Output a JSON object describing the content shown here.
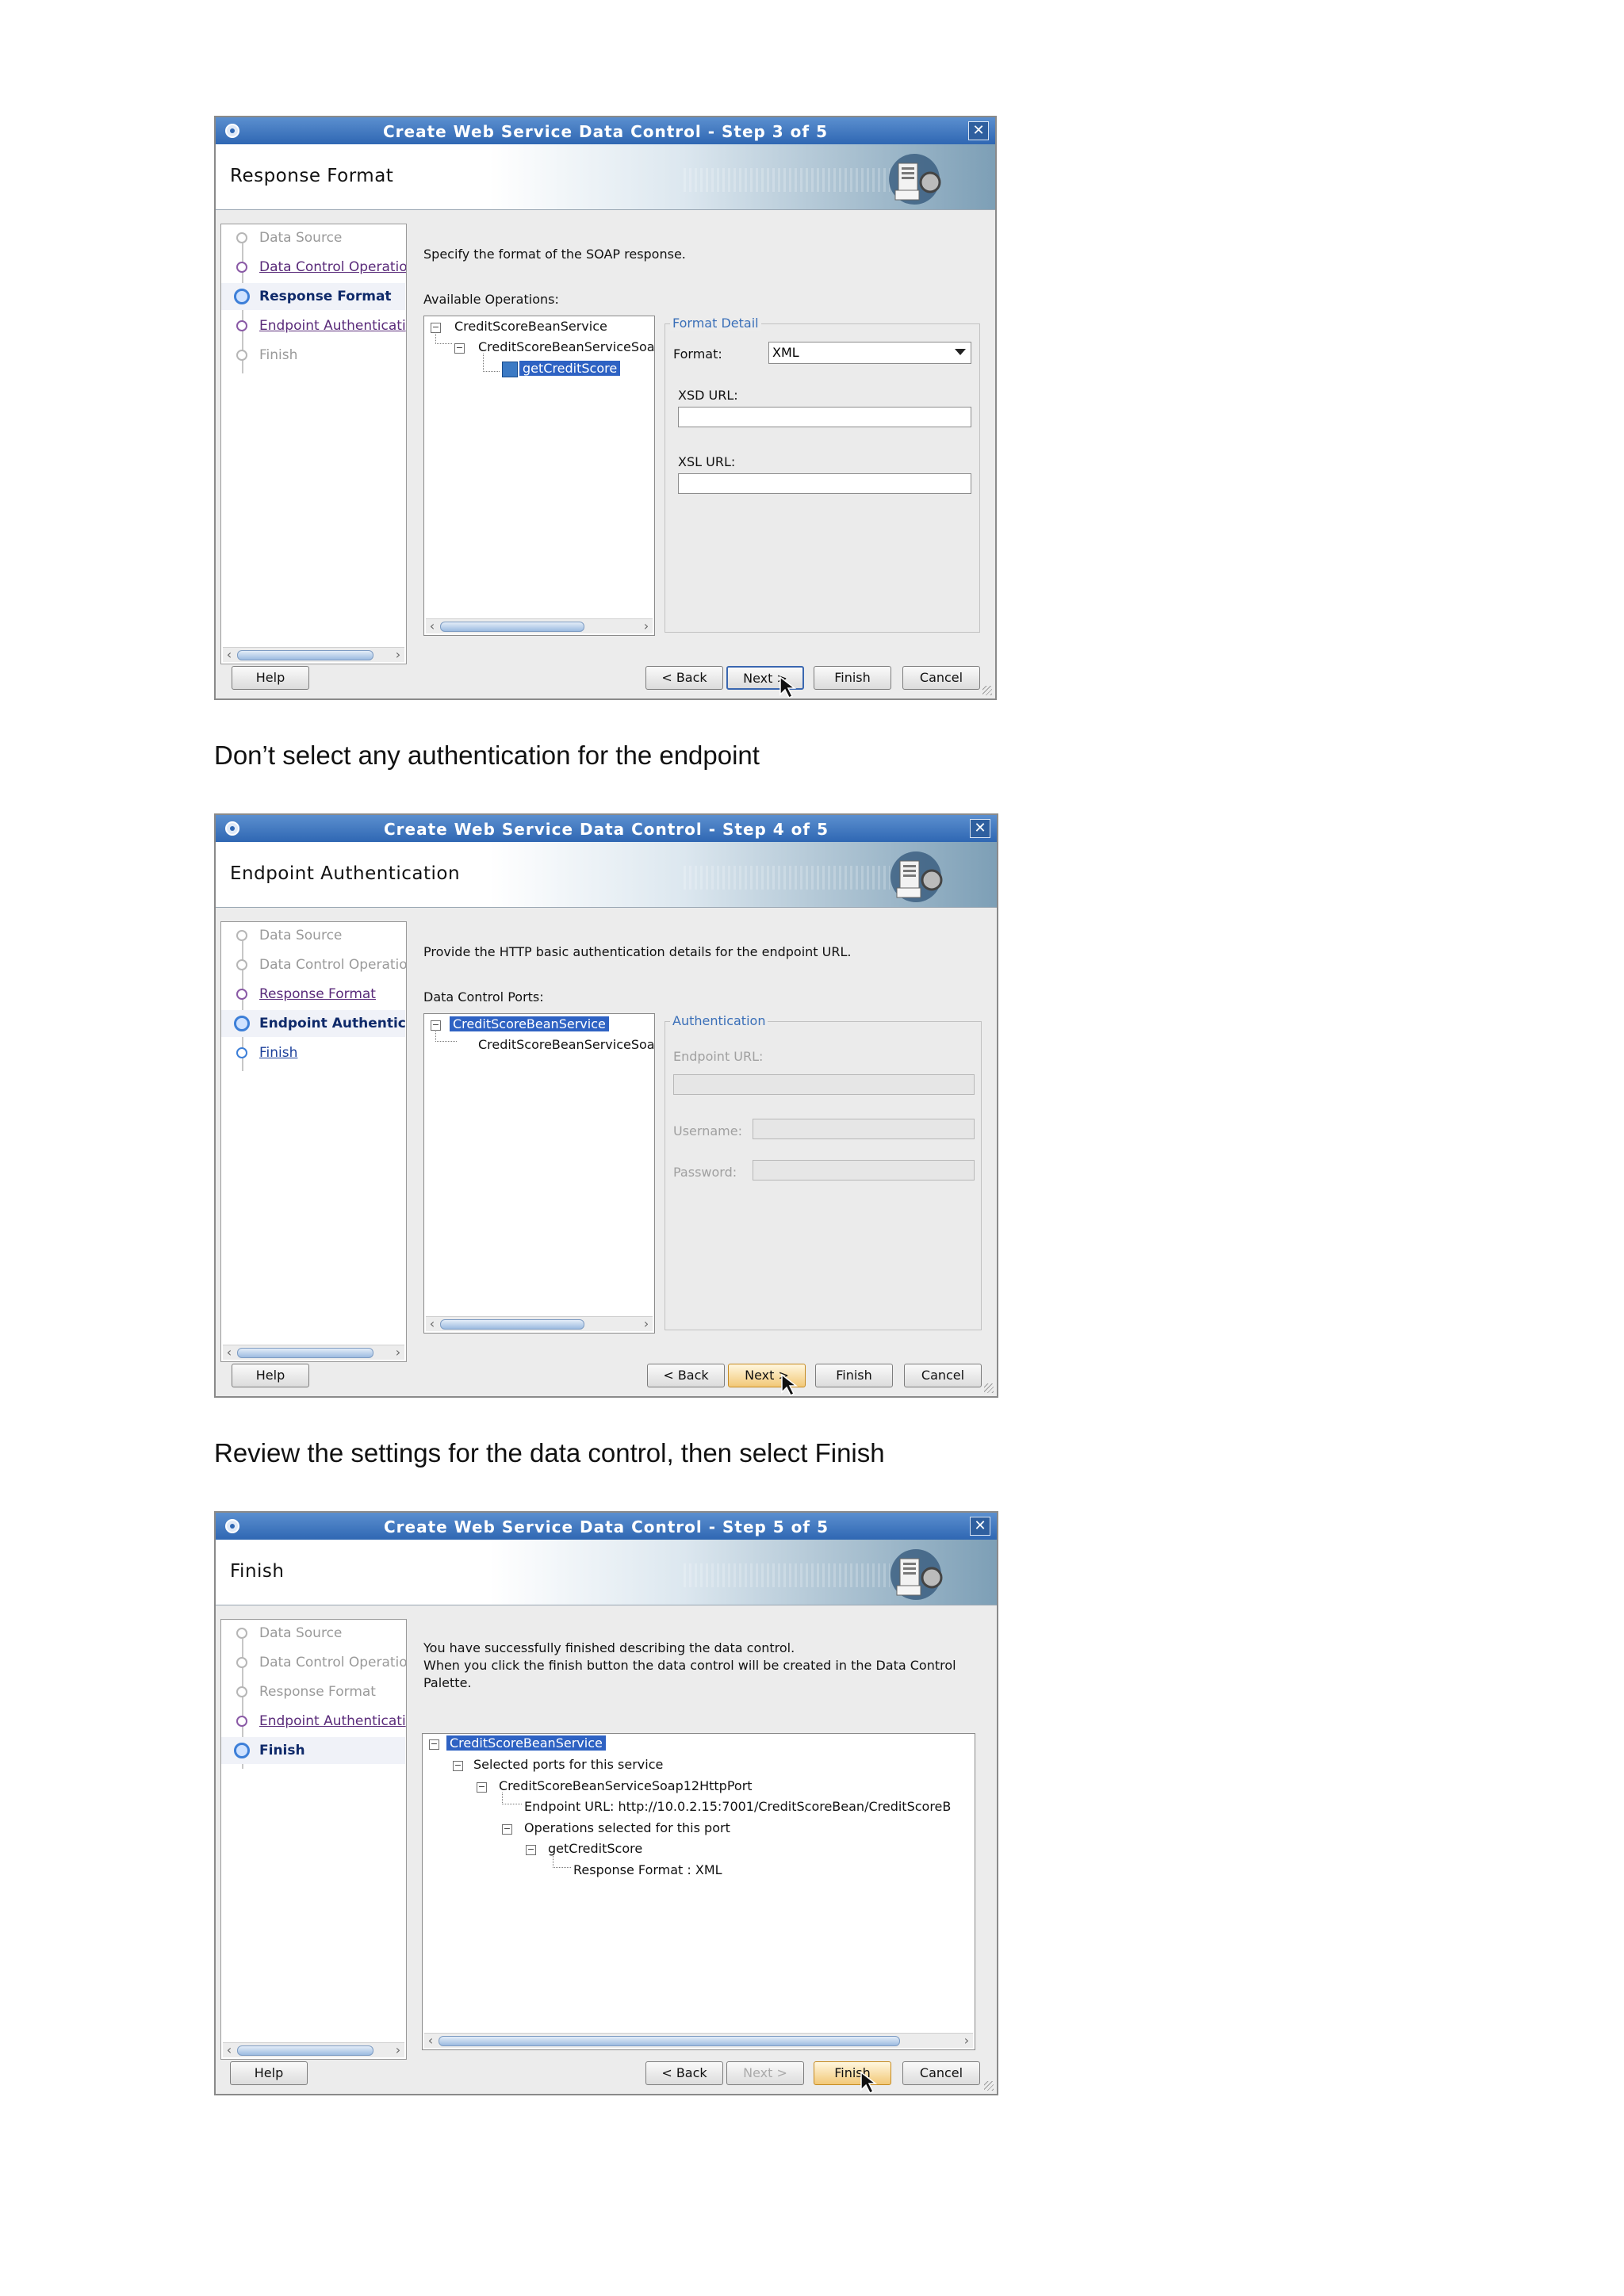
{
  "dialog1": {
    "title": "Create Web Service Data Control - Step 3 of 5",
    "header": "Response Format",
    "steps": [
      "Data Source",
      "Data Control Operatio",
      "Response Format",
      "Endpoint Authenticati",
      "Finish"
    ],
    "description": "Specify the format of the SOAP response.",
    "tree_label": "Available Operations:",
    "tree": [
      "CreditScoreBeanService",
      "CreditScoreBeanServiceSoa",
      "getCreditScore"
    ],
    "group_title": "Format Detail",
    "format_label": "Format:",
    "format_value": "XML",
    "xsd_label": "XSD URL:",
    "xsl_label": "XSL URL:",
    "buttons": {
      "help": "Help",
      "back": "< Back",
      "next": "Next >",
      "finish": "Finish",
      "cancel": "Cancel"
    }
  },
  "caption1": "Don’t select any authentication for the endpoint",
  "dialog2": {
    "title": "Create Web Service Data Control - Step 4 of 5",
    "header": "Endpoint Authentication",
    "steps": [
      "Data Source",
      "Data Control Operatio",
      "Response Format",
      "Endpoint Authenticat",
      "Finish"
    ],
    "description": "Provide the HTTP basic authentication details for the endpoint URL.",
    "tree_label": "Data Control Ports:",
    "tree": [
      "CreditScoreBeanService",
      "CreditScoreBeanServiceSoa"
    ],
    "group_title": "Authentication",
    "endpoint_label": "Endpoint URL:",
    "username_label": "Username:",
    "password_label": "Password:",
    "buttons": {
      "help": "Help",
      "back": "< Back",
      "next": "Next >",
      "finish": "Finish",
      "cancel": "Cancel"
    }
  },
  "caption2": "Review the settings for the data control, then select Finish",
  "dialog3": {
    "title": "Create Web Service Data Control - Step 5 of 5",
    "header": "Finish",
    "steps": [
      "Data Source",
      "Data Control Operatio",
      "Response Format",
      "Endpoint Authenticati",
      "Finish"
    ],
    "description_line1": "You have successfully finished describing the data control.",
    "description_line2": "When you click the finish button the data control will be created in the Data Control",
    "description_line3": "Palette.",
    "tree": [
      "CreditScoreBeanService",
      "Selected ports for this service",
      "CreditScoreBeanServiceSoap12HttpPort",
      "Endpoint URL: http://10.0.2.15:7001/CreditScoreBean/CreditScoreB",
      "Operations selected for this port",
      "getCreditScore",
      "Response Format : XML"
    ],
    "buttons": {
      "help": "Help",
      "back": "< Back",
      "next": "Next >",
      "finish": "Finish",
      "cancel": "Cancel"
    }
  },
  "colors": {
    "titlebar": "#2f67b3",
    "selection": "#2e62c3",
    "group_title": "#3a6fb8",
    "visited_link": "#5a2b7a"
  },
  "icons": [
    "app-icon",
    "close-icon",
    "header-logo-icon",
    "operation-icon",
    "mouse-cursor-icon",
    "expand-icon",
    "collapse-icon"
  ]
}
